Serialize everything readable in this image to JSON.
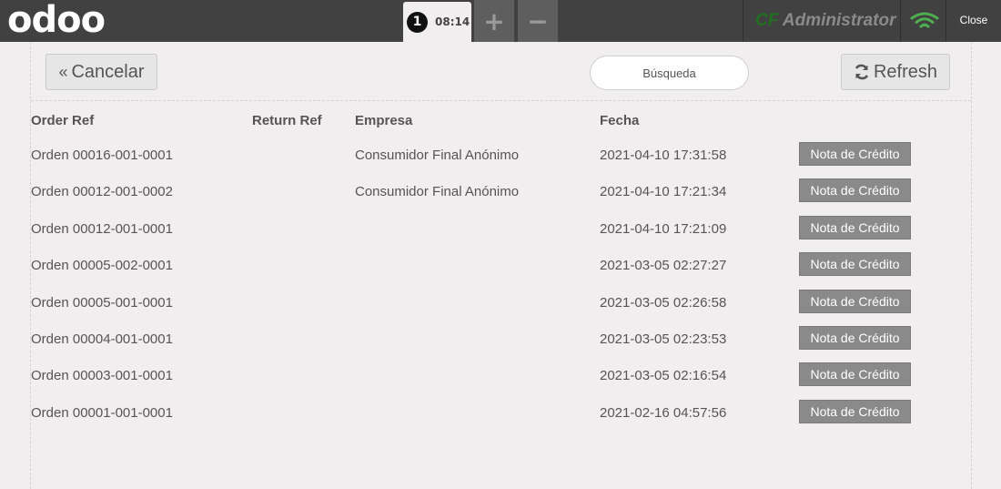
{
  "header": {
    "logo_text": "odoo",
    "order_tab": {
      "number": "1",
      "time": "08:14"
    },
    "add_order_symbol": "+",
    "remove_order_symbol": "−",
    "cashier_prefix": "CF",
    "cashier_name": "Administrator",
    "close_label": "Close",
    "colors": {
      "bar": "#414141",
      "wifi": "#4caf50",
      "cashier_prefix": "#1f6f1f"
    }
  },
  "toolbar": {
    "cancel_icon": "«",
    "cancel_label": "Cancelar",
    "search_placeholder": "Búsqueda",
    "refresh_icon": "refresh-icon",
    "refresh_label": "Refresh"
  },
  "table": {
    "columns": [
      "Order Ref",
      "Return Ref",
      "Empresa",
      "Fecha"
    ],
    "action_label": "Nota de Crédito",
    "rows": [
      {
        "order_ref": "Orden 00016-001-0001",
        "return_ref": "",
        "empresa": "Consumidor Final Anónimo",
        "fecha": "2021-04-10 17:31:58"
      },
      {
        "order_ref": "Orden 00012-001-0002",
        "return_ref": "",
        "empresa": "Consumidor Final Anónimo",
        "fecha": "2021-04-10 17:21:34"
      },
      {
        "order_ref": "Orden 00012-001-0001",
        "return_ref": "",
        "empresa": "",
        "fecha": "2021-04-10 17:21:09"
      },
      {
        "order_ref": "Orden 00005-002-0001",
        "return_ref": "",
        "empresa": "",
        "fecha": "2021-03-05 02:27:27"
      },
      {
        "order_ref": "Orden 00005-001-0001",
        "return_ref": "",
        "empresa": "",
        "fecha": "2021-03-05 02:26:58"
      },
      {
        "order_ref": "Orden 00004-001-0001",
        "return_ref": "",
        "empresa": "",
        "fecha": "2021-03-05 02:23:53"
      },
      {
        "order_ref": "Orden 00003-001-0001",
        "return_ref": "",
        "empresa": "",
        "fecha": "2021-03-05 02:16:54"
      },
      {
        "order_ref": "Orden 00001-001-0001",
        "return_ref": "",
        "empresa": "",
        "fecha": "2021-02-16 04:57:56"
      }
    ]
  }
}
